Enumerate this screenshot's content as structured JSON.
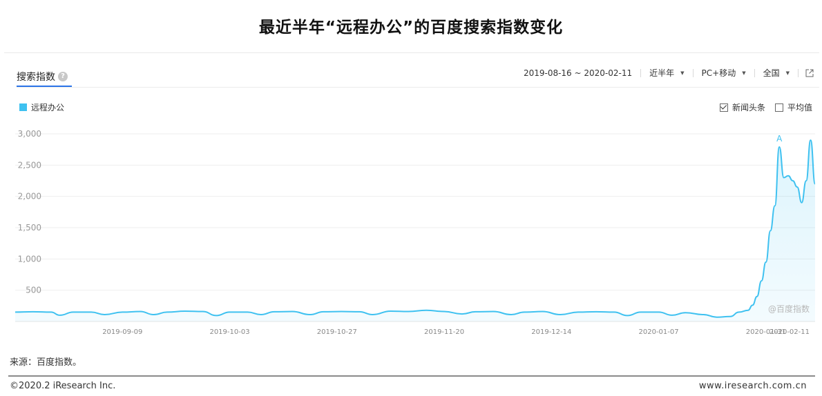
{
  "title": "最近半年“远程办公”的百度搜索指数变化",
  "tab": {
    "label": "搜索指数",
    "help_icon": "?"
  },
  "controls": {
    "date_range": "2019-08-16 ~ 2020-02-11",
    "period": "近半年",
    "device": "PC+移动",
    "region": "全国"
  },
  "checkboxes": [
    {
      "label": "新闻头条",
      "checked": true
    },
    {
      "label": "平均值",
      "checked": false
    }
  ],
  "watermark": "@百度指数",
  "source": "来源：百度指数。",
  "footer": {
    "copyright": "©2020.2 iResearch Inc.",
    "site": "www.iresearch.com.cn"
  },
  "chart_data": {
    "type": "area",
    "series": [
      {
        "name": "远程办公",
        "color": "#3ec1f0"
      }
    ],
    "ylim": [
      0,
      3000
    ],
    "y_ticks": [
      "500",
      "1,000",
      "1,500",
      "2,000",
      "2,500",
      "3,000"
    ],
    "x_ticks": [
      "2019-09-09",
      "2019-10-03",
      "2019-10-27",
      "2019-11-20",
      "2019-12-14",
      "2020-01-07",
      "2020-01-31",
      "2020-02-11"
    ],
    "annotation": {
      "label": "A",
      "date": "2020-02-03",
      "value": 2790
    },
    "baseline_level": 160,
    "points": [
      [
        "2019-08-16",
        150
      ],
      [
        "2019-08-20",
        155
      ],
      [
        "2019-08-24",
        150
      ],
      [
        "2019-08-26",
        100
      ],
      [
        "2019-08-29",
        150
      ],
      [
        "2019-09-02",
        150
      ],
      [
        "2019-09-05",
        110
      ],
      [
        "2019-09-09",
        150
      ],
      [
        "2019-09-13",
        160
      ],
      [
        "2019-09-16",
        110
      ],
      [
        "2019-09-19",
        150
      ],
      [
        "2019-09-23",
        165
      ],
      [
        "2019-09-27",
        160
      ],
      [
        "2019-09-30",
        95
      ],
      [
        "2019-10-03",
        150
      ],
      [
        "2019-10-07",
        150
      ],
      [
        "2019-10-10",
        110
      ],
      [
        "2019-10-13",
        155
      ],
      [
        "2019-10-17",
        160
      ],
      [
        "2019-10-21",
        110
      ],
      [
        "2019-10-24",
        155
      ],
      [
        "2019-10-28",
        160
      ],
      [
        "2019-11-01",
        155
      ],
      [
        "2019-11-04",
        110
      ],
      [
        "2019-11-08",
        165
      ],
      [
        "2019-11-12",
        160
      ],
      [
        "2019-11-16",
        180
      ],
      [
        "2019-11-20",
        160
      ],
      [
        "2019-11-24",
        120
      ],
      [
        "2019-11-27",
        155
      ],
      [
        "2019-12-01",
        160
      ],
      [
        "2019-12-05",
        110
      ],
      [
        "2019-12-08",
        150
      ],
      [
        "2019-12-12",
        160
      ],
      [
        "2019-12-16",
        110
      ],
      [
        "2019-12-20",
        150
      ],
      [
        "2019-12-24",
        155
      ],
      [
        "2019-12-28",
        150
      ],
      [
        "2019-12-31",
        95
      ],
      [
        "2020-01-03",
        150
      ],
      [
        "2020-01-07",
        150
      ],
      [
        "2020-01-10",
        100
      ],
      [
        "2020-01-13",
        140
      ],
      [
        "2020-01-17",
        110
      ],
      [
        "2020-01-20",
        70
      ],
      [
        "2020-01-23",
        80
      ],
      [
        "2020-01-25",
        150
      ],
      [
        "2020-01-27",
        180
      ],
      [
        "2020-01-28",
        260
      ],
      [
        "2020-01-29",
        400
      ],
      [
        "2020-01-30",
        650
      ],
      [
        "2020-01-31",
        950
      ],
      [
        "2020-02-01",
        1450
      ],
      [
        "2020-02-02",
        1850
      ],
      [
        "2020-02-03",
        2790
      ],
      [
        "2020-02-04",
        2300
      ],
      [
        "2020-02-05",
        2330
      ],
      [
        "2020-02-06",
        2250
      ],
      [
        "2020-02-07",
        2150
      ],
      [
        "2020-02-08",
        1900
      ],
      [
        "2020-02-09",
        2250
      ],
      [
        "2020-02-10",
        2900
      ],
      [
        "2020-02-11",
        2200
      ]
    ]
  }
}
